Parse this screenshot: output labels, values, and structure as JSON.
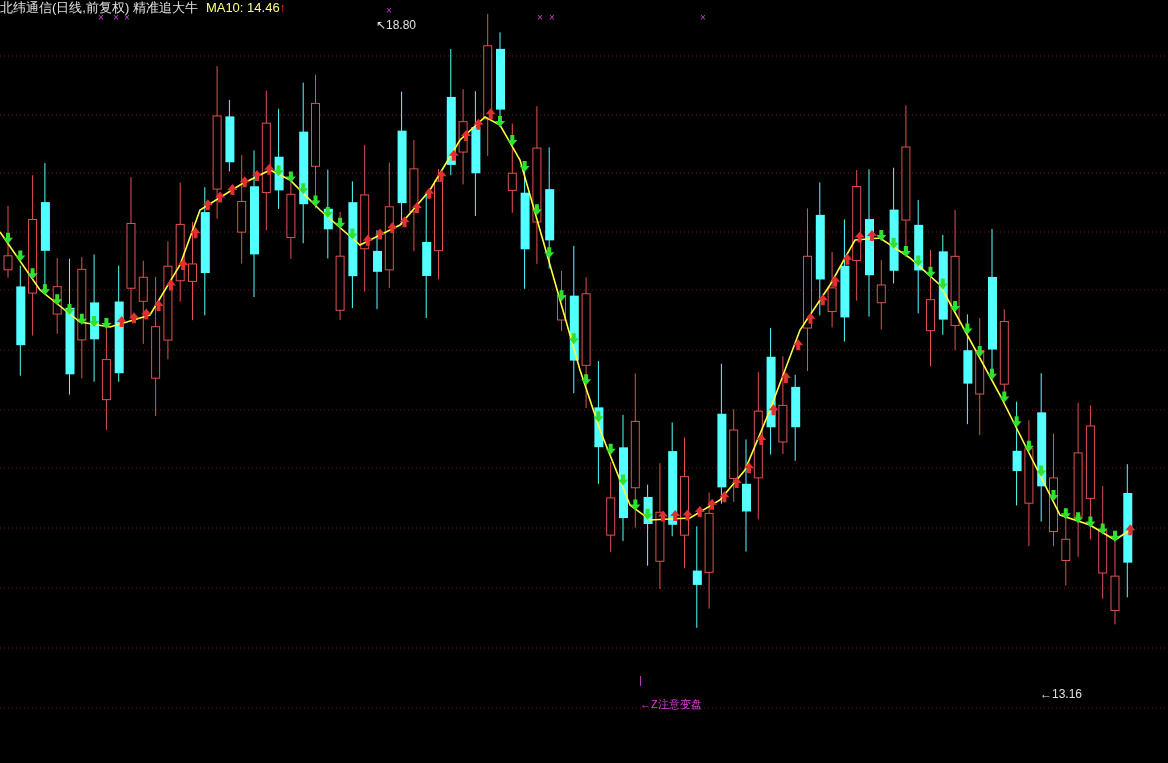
{
  "header": {
    "title": "北纬通信(日线,前复权) 精准追大牛",
    "indicator": "MA10: 14.46",
    "trend_arrow": "↑"
  },
  "signal_marks": [
    "×",
    "×",
    "×",
    "×",
    "×",
    "×",
    "×"
  ],
  "price_labels": [
    {
      "kind": "high",
      "text": "↖18.80"
    },
    {
      "kind": "low",
      "text": "←13.16"
    }
  ],
  "signal_note": {
    "tick": "|",
    "text": "←Z注意变盘"
  }
}
